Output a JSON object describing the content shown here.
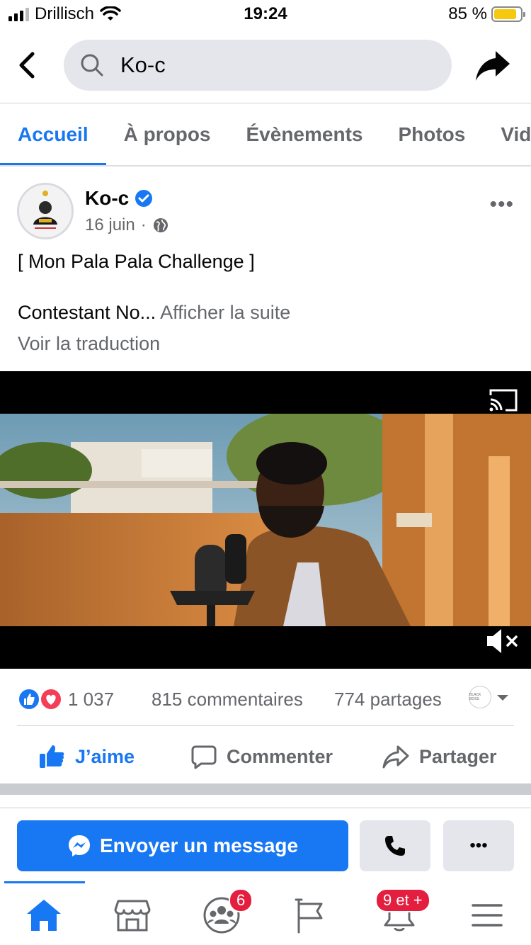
{
  "status_bar": {
    "carrier": "Drillisch",
    "time": "19:24",
    "battery_percent": "85 %",
    "battery_level": 0.85
  },
  "header": {
    "search_value": "Ko-c",
    "icons": [
      "back-arrow-icon",
      "search-icon",
      "share-arrow-icon"
    ]
  },
  "tabs": [
    {
      "label": "Accueil",
      "active": true
    },
    {
      "label": "À propos",
      "active": false
    },
    {
      "label": "Évènements",
      "active": false
    },
    {
      "label": "Photos",
      "active": false
    },
    {
      "label": "Vidé",
      "active": false
    }
  ],
  "post": {
    "author": "Ko-c",
    "date": "16 juin",
    "separator": "·",
    "title_line": "[ Mon Pala Pala Challenge ]",
    "body_truncated": "Contestant No...",
    "see_more": "Afficher la suite",
    "translate": "Voir la traduction",
    "more_menu": "•••"
  },
  "stats": {
    "reactions_count": "1 037",
    "comments": "815 commentaires",
    "shares": "774 partages",
    "page_avatar_text": "BLACK BOSS"
  },
  "actions": {
    "like": "J’aime",
    "comment": "Commenter",
    "share": "Partager"
  },
  "cta": {
    "message": "Envoyer un message",
    "more": "•••"
  },
  "bottom_nav": {
    "groups_badge": "6",
    "notifications_badge": "9 et +"
  },
  "colors": {
    "brand_blue": "#1877f2",
    "badge_red": "#e41e3f",
    "muted_text": "#65676b"
  }
}
